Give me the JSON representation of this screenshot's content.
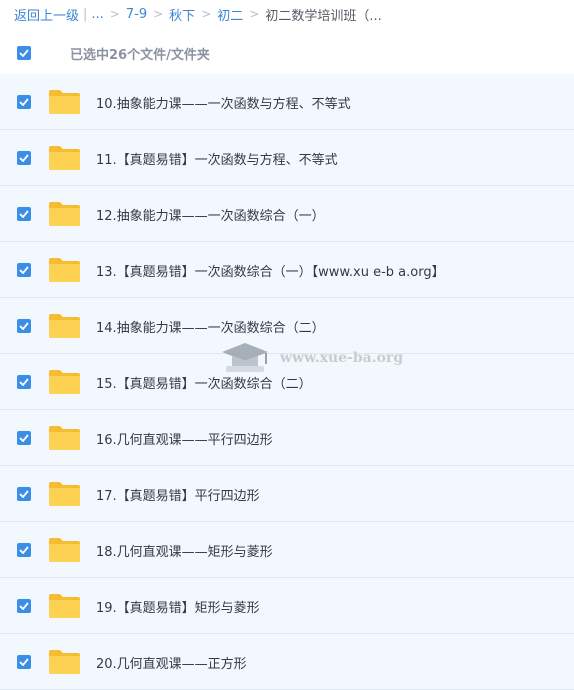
{
  "breadcrumb": {
    "back": "返回上一级",
    "ellipsis": "...",
    "items": [
      "7-9",
      "秋下",
      "初二"
    ],
    "current": "初二数学培训班（..."
  },
  "selection": {
    "text": "已选中26个文件/文件夹"
  },
  "files": [
    {
      "name": "10.抽象能力课——一次函数与方程、不等式"
    },
    {
      "name": "11.【真题易错】一次函数与方程、不等式"
    },
    {
      "name": "12.抽象能力课——一次函数综合（一）"
    },
    {
      "name": "13.【真题易错】一次函数综合（一）【www.xu e-b a.org】"
    },
    {
      "name": "14.抽象能力课——一次函数综合（二）"
    },
    {
      "name": "15.【真题易错】一次函数综合（二）"
    },
    {
      "name": "16.几何直观课——平行四边形"
    },
    {
      "name": "17.【真题易错】平行四边形"
    },
    {
      "name": "18.几何直观课——矩形与菱形"
    },
    {
      "name": "19.【真题易错】矩形与菱形"
    },
    {
      "name": "20.几何直观课——正方形"
    }
  ],
  "watermark": {
    "text": "www.xue-ba.org"
  },
  "colors": {
    "accent": "#3b8ee8",
    "link": "#3a86d6",
    "row_bg": "#f2f8fe",
    "folder": "#fdd152"
  }
}
